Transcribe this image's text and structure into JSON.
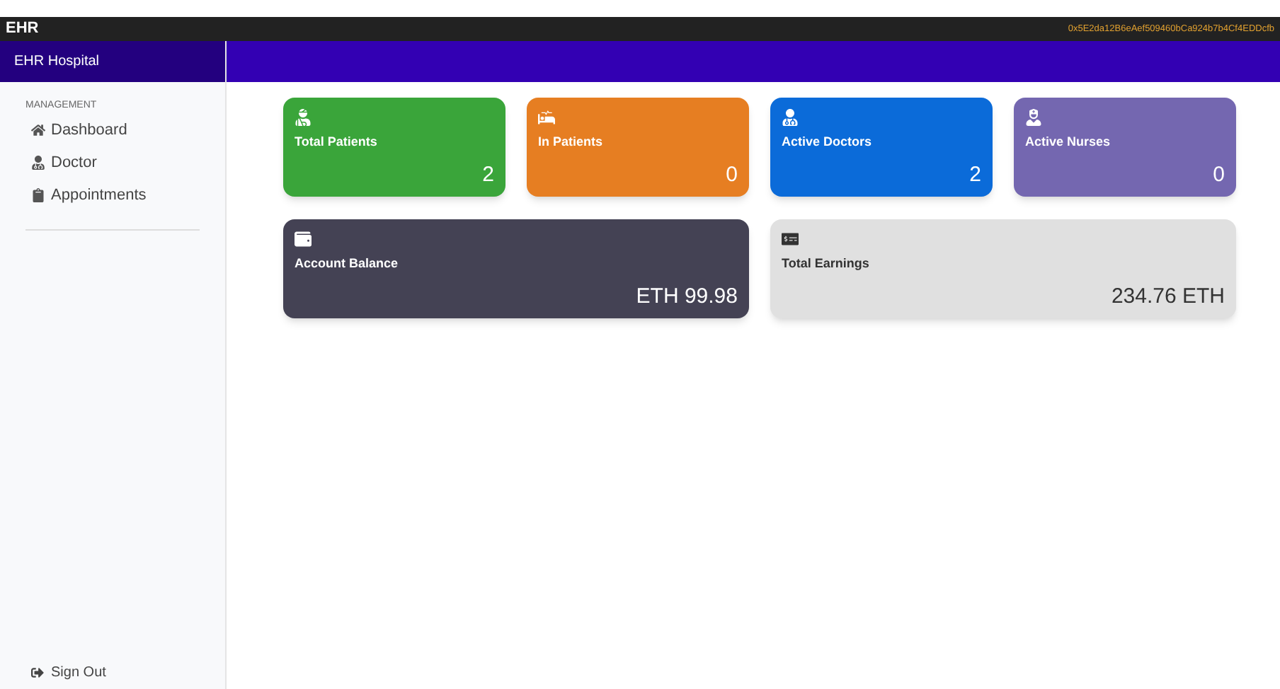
{
  "window": {
    "title": "EHR",
    "account": "0x5E2da12B6eAef509460bCa924b7b4Cf4EDDcfb"
  },
  "sidebar": {
    "brand": "EHR Hospital",
    "section": "MANAGEMENT",
    "items": [
      {
        "label": "Dashboard"
      },
      {
        "label": "Doctor"
      },
      {
        "label": "Appointments"
      }
    ],
    "sign_out": "Sign Out"
  },
  "stats": [
    {
      "label": "Total Patients",
      "value": "2",
      "color": "#3aa53a",
      "kind": "dark"
    },
    {
      "label": "In Patients",
      "value": "0",
      "color": "#e67e22",
      "kind": "dark"
    },
    {
      "label": "Active Doctors",
      "value": "2",
      "color": "#0b6bd9",
      "kind": "dark"
    },
    {
      "label": "Active Nurses",
      "value": "0",
      "color": "#7467b0",
      "kind": "dark"
    }
  ],
  "balances": [
    {
      "label": "Account Balance",
      "value": "ETH 99.98",
      "color": "#444254",
      "kind": "dark"
    },
    {
      "label": "Total Earnings",
      "value": "234.76 ETH",
      "color": "#e0e0e0",
      "kind": "light"
    }
  ]
}
